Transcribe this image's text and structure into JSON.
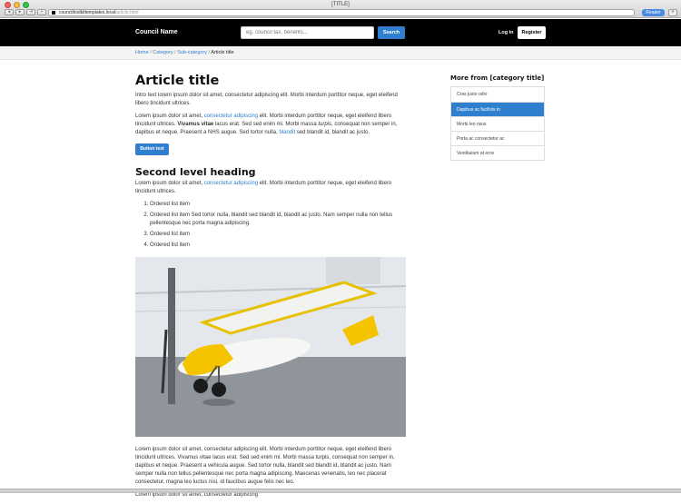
{
  "window": {
    "title": "[TITLE]",
    "url_host": "counciltoolkittemplates.local",
    "url_path": "/article.html",
    "reader_label": "Reader",
    "nav_back": "◂",
    "nav_fwd": "▸",
    "nav_box": "⇥",
    "add_tab": "+"
  },
  "header": {
    "brand": "Council Name",
    "search_placeholder": "eg. council tax, benefits...",
    "search_button": "Search",
    "login": "Log in",
    "register": "Register"
  },
  "breadcrumb": {
    "items": [
      "Home",
      "Category",
      "Sub-category"
    ],
    "separator": "/",
    "current": "Article title"
  },
  "article": {
    "title": "Article title",
    "intro": "Intro text lorem ipsum dolor sit amet, consectetur adipiscing elit. Morbi interdum porttitor neque, eget eleifend libero tincidunt ultrices.",
    "p1_a": "Lorem ipsum dolor sit amet, ",
    "p1_link": "consectetur adipiscing",
    "p1_b": " elit. Morbi interdum porttitor neque, eget eleifend libero tincidunt ultrices. ",
    "p1_bold": "Vivamus vitae",
    "p1_c": " lacus erat. Sed sed enim mi. Morbi massa ",
    "p1_em": "turpis",
    "p1_d": ", consequat non semper in, dapibus et neque. Praesent a NHS augue. Sed tortor nulla, ",
    "p1_link2": "blandit",
    "p1_e": " sed blandit id, blandit ac justo.",
    "button": "Button text",
    "h2": "Second level heading",
    "p2_a": "Lorem ipsum dolor sit amet, ",
    "p2_link": "consectetur adipiscing",
    "p2_b": " elit. Morbi interdum porttitor neque, eget eleifend libero tincidunt ultrices.",
    "list": [
      "Ordered list item",
      "Ordered list item Sed tortor nulla, blandit sed blandit id, blandit ac justo. Nam semper nulla non tellus pellentesque nec porta magna adipiscing.",
      "Ordered list item",
      "Ordered list item"
    ],
    "p3": "Lorem ipsum dolor sit amet, consectetur adipiscing elit. Morbi interdum porttitor neque, eget eleifend libero tincidunt ultrices. Vivamus vitae lacus erat. Sed sed enim mi. Morbi massa turpis, consequat non semper in, dapibus et neque. Praesent a vehicula augue. Sed tortor nulla, blandit sed blandit id, blandit ac justo. Nam semper nulla non tellus pellentesque nec porta magna adipiscing. Maecenas venenatis, leo nec placerat consectetur, magna leo luctus nisi, id faucibus augue felis nec leo.",
    "p4": "Lorem ipsum dolor sit amet, consectetur adipiscing"
  },
  "sidebar": {
    "title": "More from [category title]",
    "items": [
      "Cras justo odio",
      "Dapibus ac facilisis in",
      "Morbi leo risus",
      "Porta ac consectetur ac",
      "Vestibulum at eros"
    ],
    "active_index": 1
  },
  "colors": {
    "accent": "#2f7fce",
    "topbar": "#000000"
  }
}
